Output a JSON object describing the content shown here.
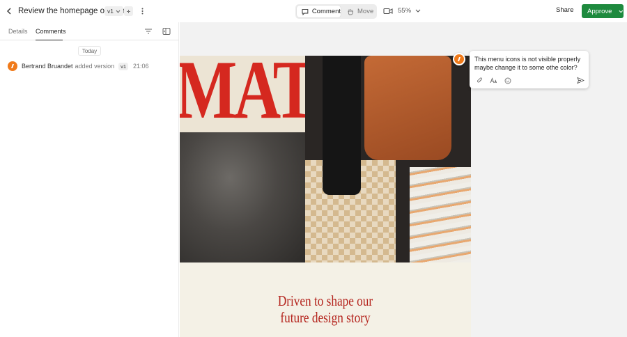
{
  "header": {
    "title": "Review the homepage of Matre",
    "version": "v1",
    "modes": {
      "comment": "Comment",
      "move": "Move"
    },
    "zoom": "55%",
    "share": "Share",
    "approve": "Approve"
  },
  "sidebar": {
    "tabs": [
      "Details",
      "Comments"
    ],
    "active_tab": "Comments",
    "date_divider": "Today",
    "activity": {
      "user": "Bertrand Bruandet",
      "action": "added version",
      "version": "v1",
      "time": "21:06"
    }
  },
  "canvas": {
    "brand_text": "MATRE",
    "headline_line1": "Driven to shape our",
    "headline_line2": "future design story"
  },
  "comment": {
    "text": "This menu icons is not visible properly maybe change it to some othe color?"
  },
  "colors": {
    "approve": "#1e8a3e",
    "avatar": "#f07a1a",
    "brand_red": "#d5281f"
  },
  "icons": [
    "back-icon",
    "chevron-down-icon",
    "plus-icon",
    "kebab-icon",
    "comment-icon",
    "hand-icon",
    "video-icon",
    "filter-icon",
    "panel-icon",
    "attach-icon",
    "text-format-icon",
    "emoji-icon",
    "send-icon"
  ]
}
